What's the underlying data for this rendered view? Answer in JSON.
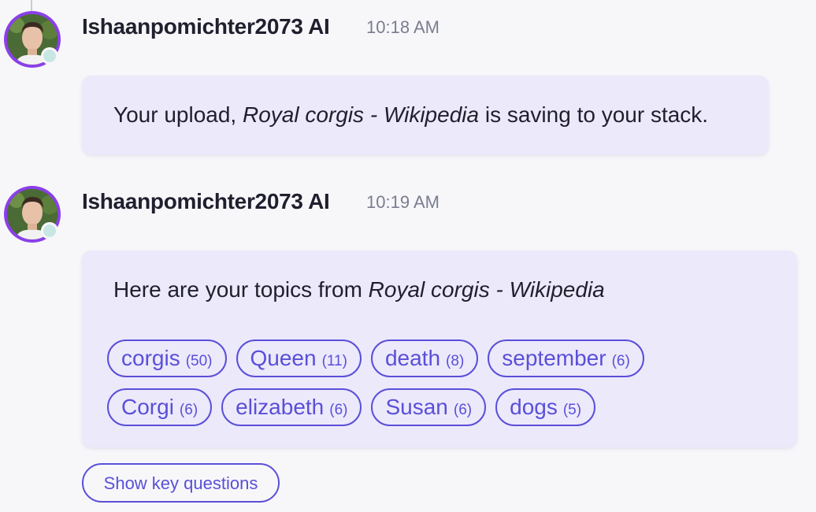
{
  "messages": [
    {
      "author": "Ishaanpomichter2073 AI",
      "time": "10:18 AM",
      "text_before": "Your upload, ",
      "text_title": "Royal corgis - Wikipedia",
      "text_after": " is saving to your stack."
    },
    {
      "author": "Ishaanpomichter2073 AI",
      "time": "10:19 AM",
      "text_before": "Here are your topics from ",
      "text_title": "Royal corgis - Wikipedia",
      "topics": [
        {
          "label": "corgis",
          "count": "(50)"
        },
        {
          "label": "Queen",
          "count": "(11)"
        },
        {
          "label": "death",
          "count": "(8)"
        },
        {
          "label": "september",
          "count": "(6)"
        },
        {
          "label": "Corgi",
          "count": "(6)"
        },
        {
          "label": "elizabeth",
          "count": "(6)"
        },
        {
          "label": "Susan",
          "count": "(6)"
        },
        {
          "label": "dogs",
          "count": "(5)"
        }
      ]
    }
  ],
  "actions": {
    "key_questions_label": "Show key questions"
  },
  "colors": {
    "accent": "#5a4fd8",
    "bubble": "#ece9fb",
    "avatar_ring": "#8b3fe8",
    "presence": "#c8e6e4"
  },
  "icons": {
    "avatar": "user-avatar-photo",
    "presence": "online-status-dot"
  }
}
